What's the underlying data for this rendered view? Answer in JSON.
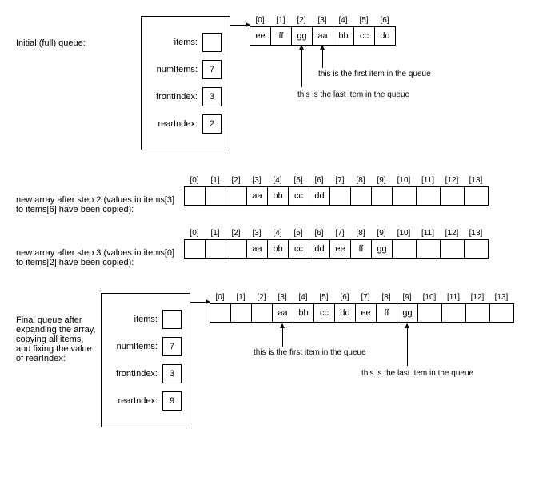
{
  "section1": {
    "label": "Initial (full) queue:",
    "fields": {
      "items": "items:",
      "numItems": {
        "label": "numItems:",
        "value": "7"
      },
      "frontIndex": {
        "label": "frontIndex:",
        "value": "3"
      },
      "rearIndex": {
        "label": "rearIndex:",
        "value": "2"
      }
    },
    "indices": [
      "[0]",
      "[1]",
      "[2]",
      "[3]",
      "[4]",
      "[5]",
      "[6]"
    ],
    "cells": [
      "ee",
      "ff",
      "gg",
      "aa",
      "bb",
      "cc",
      "dd"
    ],
    "anno_first": "this is the first item in the queue",
    "anno_last": "this is the last item in the queue"
  },
  "section2": {
    "label": "new array after step 2 (values in items[3] to items[6] have been copied):",
    "indices": [
      "[0]",
      "[1]",
      "[2]",
      "[3]",
      "[4]",
      "[5]",
      "[6]",
      "[7]",
      "[8]",
      "[9]",
      "[10]",
      "[11]",
      "[12]",
      "[13]"
    ],
    "cells": [
      "",
      "",
      "",
      "aa",
      "bb",
      "cc",
      "dd",
      "",
      "",
      "",
      "",
      "",
      "",
      ""
    ]
  },
  "section3": {
    "label": "new array after step 3 (values in items[0] to items[2] have been copied):",
    "indices": [
      "[0]",
      "[1]",
      "[2]",
      "[3]",
      "[4]",
      "[5]",
      "[6]",
      "[7]",
      "[8]",
      "[9]",
      "[10]",
      "[11]",
      "[12]",
      "[13]"
    ],
    "cells": [
      "",
      "",
      "",
      "aa",
      "bb",
      "cc",
      "dd",
      "ee",
      "ff",
      "gg",
      "",
      "",
      "",
      ""
    ]
  },
  "section4": {
    "label": "Final queue after expanding the array, copying all items, and fixing the value of rearIndex:",
    "fields": {
      "items": "items:",
      "numItems": {
        "label": "numItems:",
        "value": "7"
      },
      "frontIndex": {
        "label": "frontIndex:",
        "value": "3"
      },
      "rearIndex": {
        "label": "rearIndex:",
        "value": "9"
      }
    },
    "indices": [
      "[0]",
      "[1]",
      "[2]",
      "[3]",
      "[4]",
      "[5]",
      "[6]",
      "[7]",
      "[8]",
      "[9]",
      "[10]",
      "[11]",
      "[12]",
      "[13]"
    ],
    "cells": [
      "",
      "",
      "",
      "aa",
      "bb",
      "cc",
      "dd",
      "ee",
      "ff",
      "gg",
      "",
      "",
      "",
      ""
    ],
    "anno_first": "this is the first item in the queue",
    "anno_last": "this is the last item in the queue"
  }
}
